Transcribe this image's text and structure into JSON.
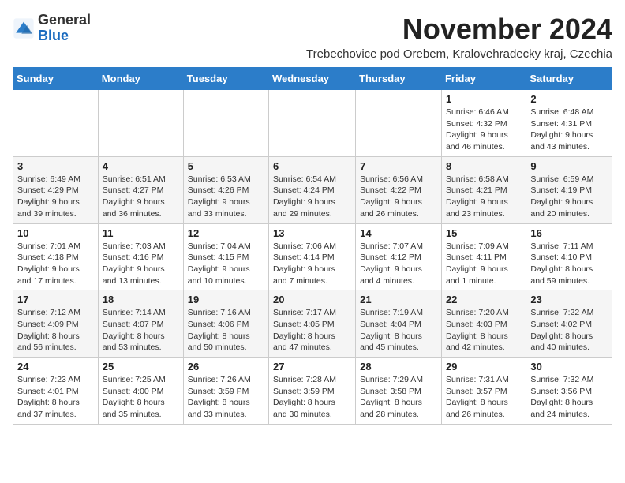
{
  "logo": {
    "general": "General",
    "blue": "Blue"
  },
  "header": {
    "title": "November 2024",
    "subtitle": "Trebechovice pod Orebem, Kralovehradecky kraj, Czechia"
  },
  "weekdays": [
    "Sunday",
    "Monday",
    "Tuesday",
    "Wednesday",
    "Thursday",
    "Friday",
    "Saturday"
  ],
  "weeks": [
    [
      {
        "day": "",
        "info": ""
      },
      {
        "day": "",
        "info": ""
      },
      {
        "day": "",
        "info": ""
      },
      {
        "day": "",
        "info": ""
      },
      {
        "day": "",
        "info": ""
      },
      {
        "day": "1",
        "info": "Sunrise: 6:46 AM\nSunset: 4:32 PM\nDaylight: 9 hours and 46 minutes."
      },
      {
        "day": "2",
        "info": "Sunrise: 6:48 AM\nSunset: 4:31 PM\nDaylight: 9 hours and 43 minutes."
      }
    ],
    [
      {
        "day": "3",
        "info": "Sunrise: 6:49 AM\nSunset: 4:29 PM\nDaylight: 9 hours and 39 minutes."
      },
      {
        "day": "4",
        "info": "Sunrise: 6:51 AM\nSunset: 4:27 PM\nDaylight: 9 hours and 36 minutes."
      },
      {
        "day": "5",
        "info": "Sunrise: 6:53 AM\nSunset: 4:26 PM\nDaylight: 9 hours and 33 minutes."
      },
      {
        "day": "6",
        "info": "Sunrise: 6:54 AM\nSunset: 4:24 PM\nDaylight: 9 hours and 29 minutes."
      },
      {
        "day": "7",
        "info": "Sunrise: 6:56 AM\nSunset: 4:22 PM\nDaylight: 9 hours and 26 minutes."
      },
      {
        "day": "8",
        "info": "Sunrise: 6:58 AM\nSunset: 4:21 PM\nDaylight: 9 hours and 23 minutes."
      },
      {
        "day": "9",
        "info": "Sunrise: 6:59 AM\nSunset: 4:19 PM\nDaylight: 9 hours and 20 minutes."
      }
    ],
    [
      {
        "day": "10",
        "info": "Sunrise: 7:01 AM\nSunset: 4:18 PM\nDaylight: 9 hours and 17 minutes."
      },
      {
        "day": "11",
        "info": "Sunrise: 7:03 AM\nSunset: 4:16 PM\nDaylight: 9 hours and 13 minutes."
      },
      {
        "day": "12",
        "info": "Sunrise: 7:04 AM\nSunset: 4:15 PM\nDaylight: 9 hours and 10 minutes."
      },
      {
        "day": "13",
        "info": "Sunrise: 7:06 AM\nSunset: 4:14 PM\nDaylight: 9 hours and 7 minutes."
      },
      {
        "day": "14",
        "info": "Sunrise: 7:07 AM\nSunset: 4:12 PM\nDaylight: 9 hours and 4 minutes."
      },
      {
        "day": "15",
        "info": "Sunrise: 7:09 AM\nSunset: 4:11 PM\nDaylight: 9 hours and 1 minute."
      },
      {
        "day": "16",
        "info": "Sunrise: 7:11 AM\nSunset: 4:10 PM\nDaylight: 8 hours and 59 minutes."
      }
    ],
    [
      {
        "day": "17",
        "info": "Sunrise: 7:12 AM\nSunset: 4:09 PM\nDaylight: 8 hours and 56 minutes."
      },
      {
        "day": "18",
        "info": "Sunrise: 7:14 AM\nSunset: 4:07 PM\nDaylight: 8 hours and 53 minutes."
      },
      {
        "day": "19",
        "info": "Sunrise: 7:16 AM\nSunset: 4:06 PM\nDaylight: 8 hours and 50 minutes."
      },
      {
        "day": "20",
        "info": "Sunrise: 7:17 AM\nSunset: 4:05 PM\nDaylight: 8 hours and 47 minutes."
      },
      {
        "day": "21",
        "info": "Sunrise: 7:19 AM\nSunset: 4:04 PM\nDaylight: 8 hours and 45 minutes."
      },
      {
        "day": "22",
        "info": "Sunrise: 7:20 AM\nSunset: 4:03 PM\nDaylight: 8 hours and 42 minutes."
      },
      {
        "day": "23",
        "info": "Sunrise: 7:22 AM\nSunset: 4:02 PM\nDaylight: 8 hours and 40 minutes."
      }
    ],
    [
      {
        "day": "24",
        "info": "Sunrise: 7:23 AM\nSunset: 4:01 PM\nDaylight: 8 hours and 37 minutes."
      },
      {
        "day": "25",
        "info": "Sunrise: 7:25 AM\nSunset: 4:00 PM\nDaylight: 8 hours and 35 minutes."
      },
      {
        "day": "26",
        "info": "Sunrise: 7:26 AM\nSunset: 3:59 PM\nDaylight: 8 hours and 33 minutes."
      },
      {
        "day": "27",
        "info": "Sunrise: 7:28 AM\nSunset: 3:59 PM\nDaylight: 8 hours and 30 minutes."
      },
      {
        "day": "28",
        "info": "Sunrise: 7:29 AM\nSunset: 3:58 PM\nDaylight: 8 hours and 28 minutes."
      },
      {
        "day": "29",
        "info": "Sunrise: 7:31 AM\nSunset: 3:57 PM\nDaylight: 8 hours and 26 minutes."
      },
      {
        "day": "30",
        "info": "Sunrise: 7:32 AM\nSunset: 3:56 PM\nDaylight: 8 hours and 24 minutes."
      }
    ]
  ]
}
